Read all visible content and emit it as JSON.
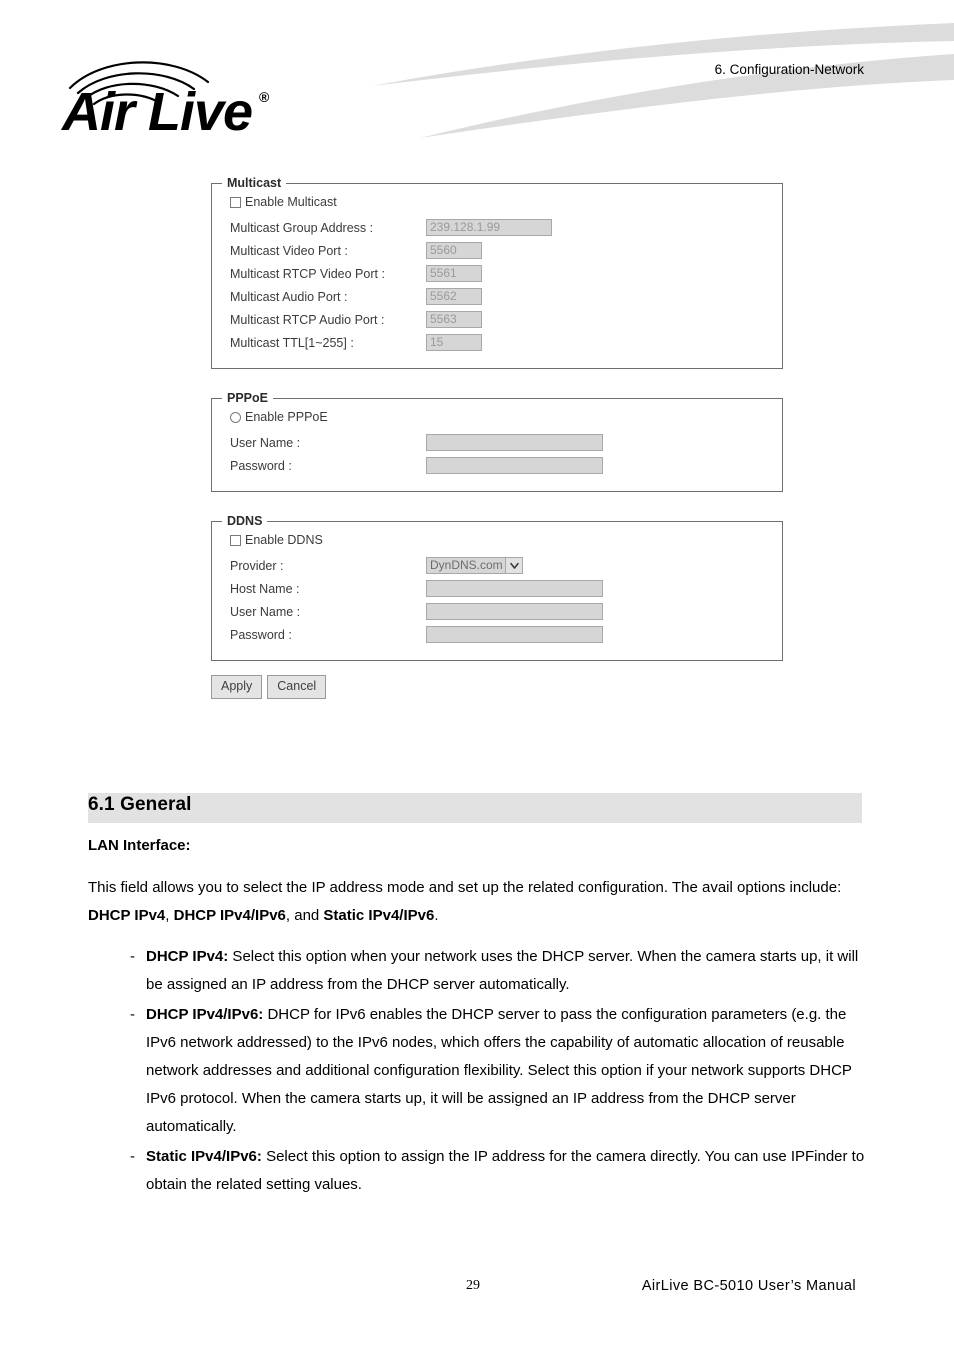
{
  "header": {
    "logo_text": "Air Live",
    "logo_trademark": "®",
    "breadcrumb": "6.  Configuration-Network"
  },
  "screenshot": {
    "multicast": {
      "legend": "Multicast",
      "enable_label": "Enable Multicast",
      "enable_checked": false,
      "fields": [
        {
          "label": "Multicast Group Address :",
          "value": "239.128.1.99",
          "width": "w-ip"
        },
        {
          "label": "Multicast Video Port :",
          "value": "5560",
          "width": "w-port"
        },
        {
          "label": "Multicast RTCP Video Port :",
          "value": "5561",
          "width": "w-port"
        },
        {
          "label": "Multicast Audio Port :",
          "value": "5562",
          "width": "w-port"
        },
        {
          "label": "Multicast RTCP Audio Port :",
          "value": "5563",
          "width": "w-port"
        },
        {
          "label": "Multicast TTL[1~255] :",
          "value": "15",
          "width": "w-ttl"
        }
      ]
    },
    "pppoe": {
      "legend": "PPPoE",
      "enable_label": "Enable PPPoE",
      "enable_checked": false,
      "fields": [
        {
          "label": "User Name :",
          "value": "",
          "width": "w-wide"
        },
        {
          "label": "Password :",
          "value": "",
          "width": "w-wide"
        }
      ]
    },
    "ddns": {
      "legend": "DDNS",
      "enable_label": "Enable DDNS",
      "enable_checked": false,
      "provider_label": "Provider :",
      "provider_value": "DynDNS.com",
      "fields": [
        {
          "label": "Host Name :",
          "value": "",
          "width": "w-wide"
        },
        {
          "label": "User Name :",
          "value": "",
          "width": "w-wide"
        },
        {
          "label": "Password :",
          "value": "",
          "width": "w-wide"
        }
      ]
    },
    "buttons": {
      "apply": "Apply",
      "cancel": "Cancel"
    }
  },
  "section": {
    "number_title": "6.1 General",
    "subhead": "LAN Interface:",
    "intro_line1": "This field allows you to select the IP address mode and set up the related configuration.",
    "intro_line2_pre": "The avail options include: ",
    "intro_opt1": "DHCP IPv4",
    "intro_sep1": ", ",
    "intro_opt2": "DHCP IPv4/IPv6",
    "intro_sep2": ", and ",
    "intro_opt3": "Static IPv4/IPv6",
    "intro_end": ".",
    "bullets": [
      {
        "dash": "-",
        "term": "DHCP IPv4:",
        "text": " Select this option when your network uses the DHCP server. When the camera starts up, it will be assigned an IP address from the DHCP server automatically."
      },
      {
        "dash": "-",
        "term": "DHCP IPv4/IPv6:",
        "text": " DHCP for IPv6 enables the DHCP server to pass the configuration parameters (e.g. the IPv6 network addressed) to the IPv6 nodes, which offers the capability of automatic allocation of reusable network addresses and additional configuration flexibility. Select this option if your network supports DHCP IPv6 protocol. When the camera starts up, it will be assigned an IP address from the DHCP server automatically."
      },
      {
        "dash": "-",
        "term": "Static IPv4/IPv6:",
        "text": " Select this option to assign the IP address for the camera directly. You can use IPFinder to obtain the related setting values."
      }
    ]
  },
  "footer": {
    "page_number": "29",
    "manual_text": "AirLive  BC-5010  User’s  Manual"
  },
  "colors": {
    "swoosh": "#dcdcdc",
    "section_bar": "#e2e2e2",
    "field_fill": "#d6d6d6",
    "field_border": "#a8a8a8",
    "group_border": "#6f6f6f"
  }
}
